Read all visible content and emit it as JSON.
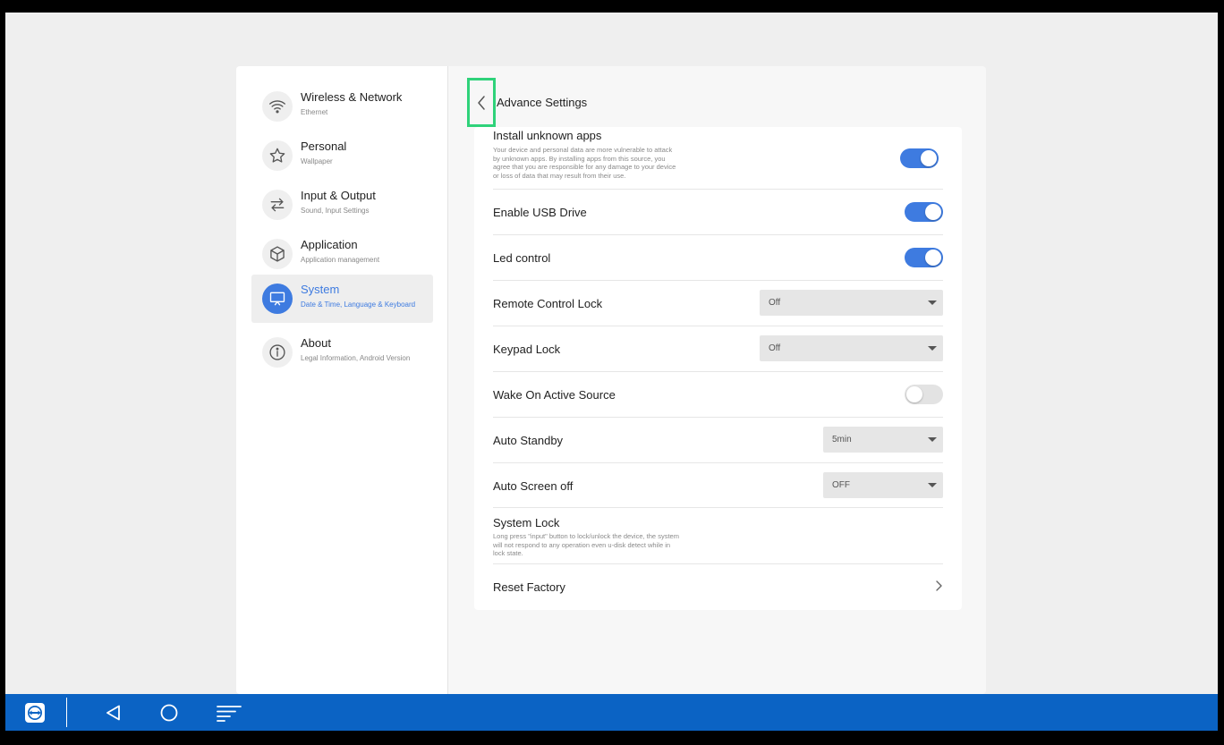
{
  "sidebar": {
    "items": [
      {
        "title": "Wireless & Network",
        "subtitle": "Ethernet",
        "icon": "wifi-icon",
        "active": false
      },
      {
        "title": "Personal",
        "subtitle": "Wallpaper",
        "icon": "star-icon",
        "active": false
      },
      {
        "title": "Input & Output",
        "subtitle": "Sound, Input Settings",
        "icon": "swap-arrows-icon",
        "active": false
      },
      {
        "title": "Application",
        "subtitle": "Application management",
        "icon": "cube-icon",
        "active": false
      },
      {
        "title": "System",
        "subtitle": "Date & Time, Language & Keyboard",
        "icon": "monitor-icon",
        "active": true
      },
      {
        "title": "About",
        "subtitle": "Legal Information, Android Version",
        "icon": "info-icon",
        "active": false
      }
    ]
  },
  "header": {
    "title": "Advance Settings",
    "back_icon": "chevron-left-icon"
  },
  "settings": {
    "install_unknown_apps": {
      "label": "Install unknown apps",
      "description": "Your device and personal data are more vulnerable to attack by unknown apps. By installing apps from this source, you agree that you are responsible for any damage to your device or loss of data that may result from their use.",
      "enabled": true
    },
    "enable_usb_drive": {
      "label": "Enable USB Drive",
      "enabled": true
    },
    "led_control": {
      "label": "Led control",
      "enabled": true
    },
    "remote_control_lock": {
      "label": "Remote Control Lock",
      "value": "Off"
    },
    "keypad_lock": {
      "label": "Keypad Lock",
      "value": "Off"
    },
    "wake_on_active_source": {
      "label": "Wake On Active Source",
      "enabled": false
    },
    "auto_standby": {
      "label": "Auto Standby",
      "value": "5min"
    },
    "auto_screen_off": {
      "label": "Auto Screen off",
      "value": "OFF"
    },
    "system_lock": {
      "label": "System Lock",
      "description": "Long press \"input\" button to lock/unlock the device, the system will not respond to any operation even u-disk detect while in lock state."
    },
    "reset_factory": {
      "label": "Reset Factory"
    }
  },
  "taskbar": {
    "items": [
      "teamviewer-icon",
      "back-triangle-icon",
      "home-circle-icon",
      "menu-lines-icon"
    ]
  },
  "colors": {
    "accent": "#3e7be0",
    "taskbar": "#0b63c4",
    "highlight_border": "#2fd27a"
  }
}
